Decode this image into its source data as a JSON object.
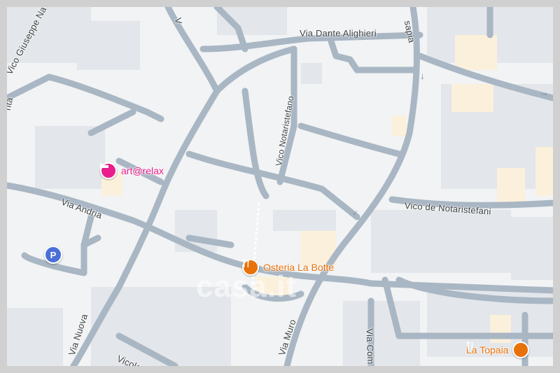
{
  "streets": {
    "via_dante_alighieri": "Via Dante Alighieri",
    "via_giuseppe_n": "Vico Giuseppe Na",
    "via_sapia": "sapia",
    "vico_notaristefano": "Vico Notaristefano",
    "vico_de_notaristefani": "Vico de Notaristefani",
    "via_andria": "Via Andria",
    "via_nuova": "Via Nuova",
    "vicolo": "Vicolo P",
    "via_muro": "Via Muro",
    "via_com": "Via Com",
    "left_edge": "nta",
    "top_v": "V"
  },
  "pois": {
    "art_relax": {
      "label": "art@relax",
      "icon": "bed-icon",
      "color": "#e91e8c"
    },
    "osteria": {
      "label": "Osteria La Botte",
      "icon": "fork-knife-icon",
      "color": "#e8710a"
    },
    "la_topaia": {
      "label": "La Topaia",
      "icon": "fork-knife-icon",
      "color": "#e8710a"
    },
    "parking": {
      "label": "P",
      "color": "#4a6fd8"
    }
  },
  "watermark": "casa.it"
}
